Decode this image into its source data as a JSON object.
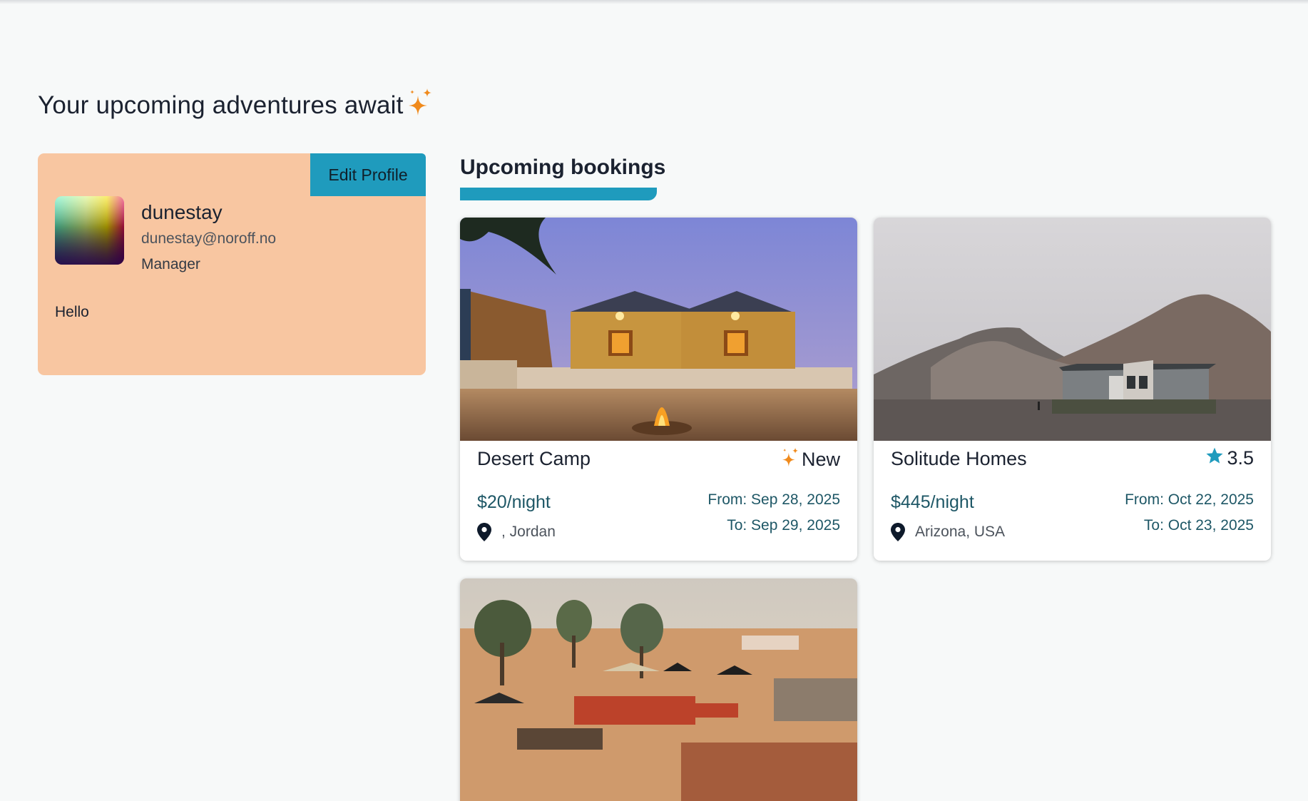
{
  "page": {
    "title": "Your upcoming adventures await"
  },
  "profile": {
    "edit_label": "Edit Profile",
    "name": "dunestay",
    "email": "dunestay@noroff.no",
    "role": "Manager",
    "bio": "Hello"
  },
  "bookings": {
    "section_title": "Upcoming bookings",
    "items": [
      {
        "title": "Desert Camp",
        "tag": "New",
        "tag_icon": "sparkle-icon",
        "price": "$20/night",
        "from": "From: Sep 28, 2025",
        "to": "To: Sep 29, 2025",
        "location": ", Jordan"
      },
      {
        "title": "Solitude Homes",
        "tag": "3.5",
        "tag_icon": "star-icon",
        "price": "$445/night",
        "from": "From: Oct 22, 2025",
        "to": "To: Oct 23, 2025",
        "location": "Arizona, USA"
      },
      {
        "title": "",
        "price": "",
        "from": "",
        "to": "",
        "location": ""
      }
    ]
  },
  "colors": {
    "accent": "#1f9bbd",
    "profile_card": "#f8c6a1",
    "sparkle": "#f08a1c",
    "text_dark": "#1b2230",
    "price_text": "#1e5766"
  }
}
